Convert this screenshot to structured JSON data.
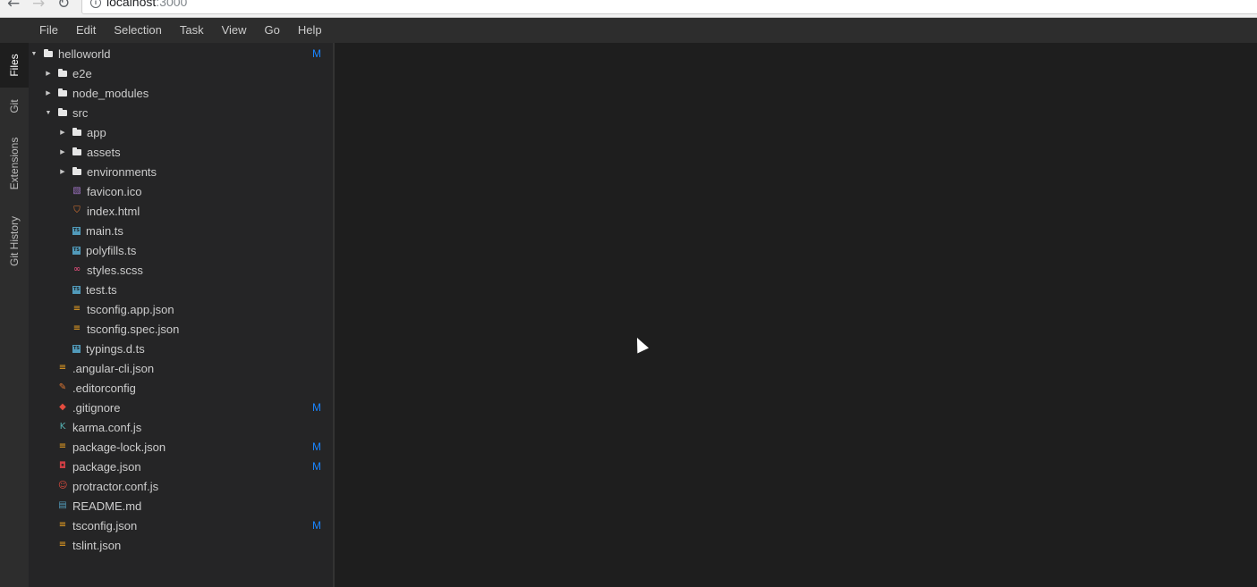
{
  "browser": {
    "back_glyph": "←",
    "forward_glyph": "→",
    "reload_glyph": "↻",
    "info_glyph": "i",
    "url_host": "localhost",
    "url_port": ":3000"
  },
  "menu": [
    "File",
    "Edit",
    "Selection",
    "Task",
    "View",
    "Go",
    "Help"
  ],
  "side_tabs": {
    "files": "Files",
    "git": "Git",
    "extensions": "Extensions",
    "git_history": "Git History",
    "active": "Files"
  },
  "tree": [
    {
      "name": "helloworld",
      "type": "folder",
      "expanded": true,
      "badge": "M"
    },
    {
      "name": "e2e",
      "type": "folder",
      "expanded": false,
      "badge": ""
    },
    {
      "name": "node_modules",
      "type": "folder",
      "expanded": false,
      "badge": ""
    },
    {
      "name": "src",
      "type": "folder",
      "expanded": true,
      "badge": ""
    },
    {
      "name": "app",
      "type": "folder",
      "expanded": false,
      "badge": ""
    },
    {
      "name": "assets",
      "type": "folder",
      "expanded": false,
      "badge": ""
    },
    {
      "name": "environments",
      "type": "folder",
      "expanded": false,
      "badge": ""
    },
    {
      "name": "favicon.ico",
      "type": "file",
      "icon": "image-file-icon",
      "badge": ""
    },
    {
      "name": "index.html",
      "type": "file",
      "icon": "html-file-icon",
      "badge": ""
    },
    {
      "name": "main.ts",
      "type": "file",
      "icon": "typescript-file-icon",
      "badge": ""
    },
    {
      "name": "polyfills.ts",
      "type": "file",
      "icon": "typescript-file-icon",
      "badge": ""
    },
    {
      "name": "styles.scss",
      "type": "file",
      "icon": "scss-file-icon",
      "badge": ""
    },
    {
      "name": "test.ts",
      "type": "file",
      "icon": "typescript-file-icon",
      "badge": ""
    },
    {
      "name": "tsconfig.app.json",
      "type": "file",
      "icon": "json-file-icon",
      "badge": ""
    },
    {
      "name": "tsconfig.spec.json",
      "type": "file",
      "icon": "json-file-icon",
      "badge": ""
    },
    {
      "name": "typings.d.ts",
      "type": "file",
      "icon": "typescript-file-icon",
      "badge": ""
    },
    {
      "name": ".angular-cli.json",
      "type": "file",
      "icon": "json-file-icon",
      "badge": ""
    },
    {
      "name": ".editorconfig",
      "type": "file",
      "icon": "editorconfig-file-icon",
      "badge": ""
    },
    {
      "name": ".gitignore",
      "type": "file",
      "icon": "git-file-icon",
      "badge": "M"
    },
    {
      "name": "karma.conf.js",
      "type": "file",
      "icon": "karma-file-icon",
      "badge": ""
    },
    {
      "name": "package-lock.json",
      "type": "file",
      "icon": "json-file-icon",
      "badge": "M"
    },
    {
      "name": "package.json",
      "type": "file",
      "icon": "npm-file-icon",
      "badge": "M"
    },
    {
      "name": "protractor.conf.js",
      "type": "file",
      "icon": "protractor-file-icon",
      "badge": ""
    },
    {
      "name": "README.md",
      "type": "file",
      "icon": "markdown-file-icon",
      "badge": ""
    },
    {
      "name": "tsconfig.json",
      "type": "file",
      "icon": "json-file-icon",
      "badge": "M"
    },
    {
      "name": "tslint.json",
      "type": "file",
      "icon": "json-file-icon",
      "badge": ""
    }
  ],
  "colors": {
    "background": "#1e1e1e",
    "panel": "#252526",
    "menubar": "#2d2d2d",
    "badge_modified": "#1a85ff"
  }
}
